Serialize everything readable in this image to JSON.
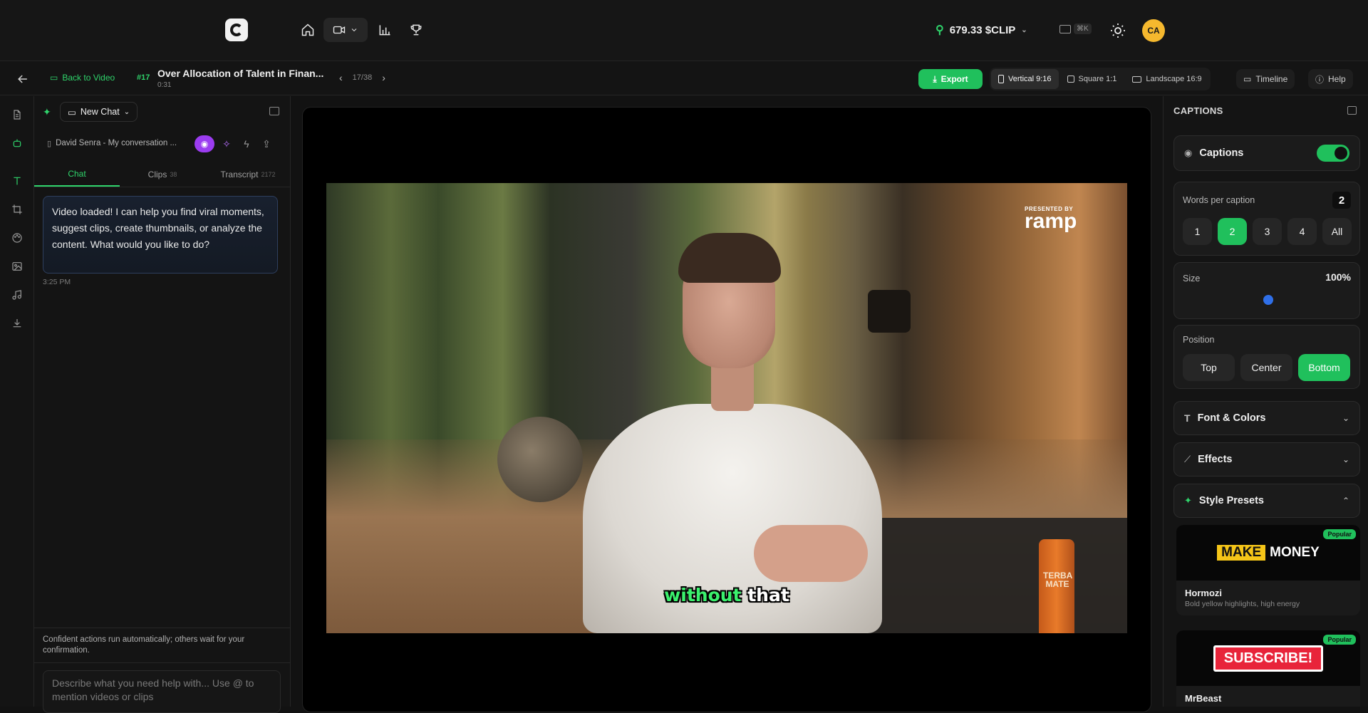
{
  "topnav": {
    "balance": "679.33 $CLIP",
    "shortcut": "⌘K",
    "avatar_initials": "CA"
  },
  "toolbar": {
    "back_label": "Back to Video",
    "clip_number": "#17",
    "clip_title": "Over Allocation of Talent in Finan...",
    "clip_duration": "0:31",
    "pager": "17/38",
    "export_label": "Export",
    "aspects": [
      {
        "label": "Vertical 9:16",
        "active": true
      },
      {
        "label": "Square 1:1",
        "active": false
      },
      {
        "label": "Landscape 16:9",
        "active": false
      }
    ],
    "timeline_label": "Timeline",
    "help_label": "Help"
  },
  "chat": {
    "new_chat_label": "New Chat",
    "conversation_title": "David Senra - My conversation ...",
    "tabs": [
      {
        "label": "Chat",
        "count": ""
      },
      {
        "label": "Clips",
        "count": "38"
      },
      {
        "label": "Transcript",
        "count": "2172"
      }
    ],
    "message": "Video loaded! I can help you find viral moments, suggest clips, create thumbnails, or analyze the content. What would you like to do?",
    "message_time": "3:25 PM",
    "confident_note": "Confident actions run automatically; others wait for your confirmation.",
    "composer_placeholder": "Describe what you need help with... Use @ to mention videos or clips"
  },
  "video": {
    "watermark_small": "PRESENTED BY",
    "watermark_brand": "ramp",
    "can_text": "TERBA MATE",
    "caption_highlight": "without",
    "caption_rest": "that"
  },
  "captions_panel": {
    "title": "CAPTIONS",
    "captions_label": "Captions",
    "captions_enabled": true,
    "words_per_caption_label": "Words per caption",
    "words_per_caption_value": "2",
    "word_options": [
      "1",
      "2",
      "3",
      "4",
      "All"
    ],
    "size_label": "Size",
    "size_value": "100%",
    "position_label": "Position",
    "position_options": [
      "Top",
      "Center",
      "Bottom"
    ],
    "position_selected": "Bottom",
    "font_colors_label": "Font & Colors",
    "effects_label": "Effects",
    "style_presets_label": "Style Presets",
    "presets": [
      {
        "badge": "Popular",
        "thumb_word1": "MAKE",
        "thumb_word2": "MONEY",
        "name": "Hormozi",
        "desc": "Bold yellow highlights, high energy"
      },
      {
        "badge": "Popular",
        "thumb_word1": "SUBSCRIBE!",
        "name": "MrBeast"
      }
    ]
  },
  "colors": {
    "accent": "#20c05c",
    "purple": "#9b3cf0",
    "background": "#121212"
  }
}
